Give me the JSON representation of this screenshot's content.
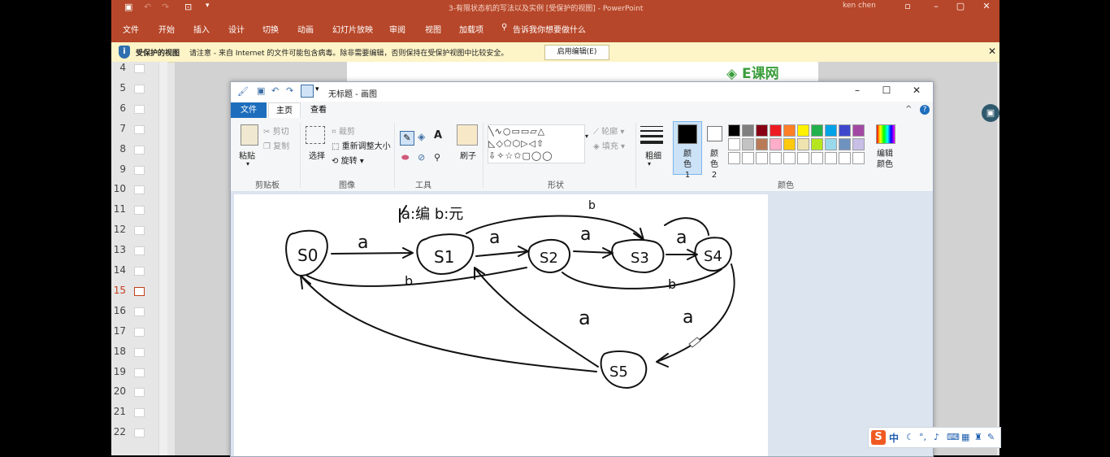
{
  "ppt": {
    "window_title": "3-有限状态机的写法以及实例 [受保护的视图] - PowerPoint",
    "user": "ken chen",
    "ribbon_tabs": [
      "文件",
      "开始",
      "插入",
      "设计",
      "切换",
      "动画",
      "幻灯片放映",
      "审阅",
      "视图",
      "加载项"
    ],
    "tell_me": "告诉我你想要做什么",
    "protected": {
      "title": "受保护的视图",
      "message": "请注意 - 来自 Internet 的文件可能包含病毒。除非需要编辑，否则保持在受保护视图中比较安全。",
      "enable_button": "启用编辑(E)"
    },
    "slide_numbers": [
      "4",
      "5",
      "6",
      "7",
      "8",
      "9",
      "10",
      "11",
      "12",
      "13",
      "14",
      "15",
      "16",
      "17",
      "18",
      "19",
      "20",
      "21",
      "22"
    ],
    "active_slide": "15",
    "watermark": "E课网"
  },
  "paint": {
    "title": "无标题 - 画图",
    "tabs": [
      "文件",
      "主页",
      "查看"
    ],
    "clipboard": {
      "paste": "粘贴",
      "cut": "剪切",
      "copy": "复制",
      "label": "剪贴板"
    },
    "image": {
      "select": "选择",
      "crop": "裁剪",
      "resize": "重新调整大小",
      "rotate": "旋转",
      "label": "图像"
    },
    "tools": {
      "brush": "刷子",
      "label": "工具"
    },
    "shapes": {
      "outline": "轮廓",
      "fill": "填充",
      "label": "形状"
    },
    "size": "粗细",
    "color1": "颜色 1",
    "color2": "颜色 2",
    "edit_colors": "编辑颜色",
    "colors_label": "颜色",
    "palette_row1": [
      "#000000",
      "#7f7f7f",
      "#880015",
      "#ed1c24",
      "#ff7f27",
      "#fff200",
      "#22b14c",
      "#00a2e8",
      "#3f48cc",
      "#a349a4"
    ],
    "palette_row2": [
      "#ffffff",
      "#c3c3c3",
      "#b97a57",
      "#ffaec9",
      "#ffc90e",
      "#efe4b0",
      "#b5e61d",
      "#99d9ea",
      "#7092be",
      "#c8bfe7"
    ],
    "sketch_labels": {
      "s0": "S0",
      "s1": "S1",
      "s2": "S2",
      "s3": "S3",
      "s4": "S4",
      "s5": "S5",
      "header": "a:编 b:元",
      "a": "a",
      "b": "b"
    }
  },
  "ime": {
    "logo": "S",
    "lang": "中"
  }
}
